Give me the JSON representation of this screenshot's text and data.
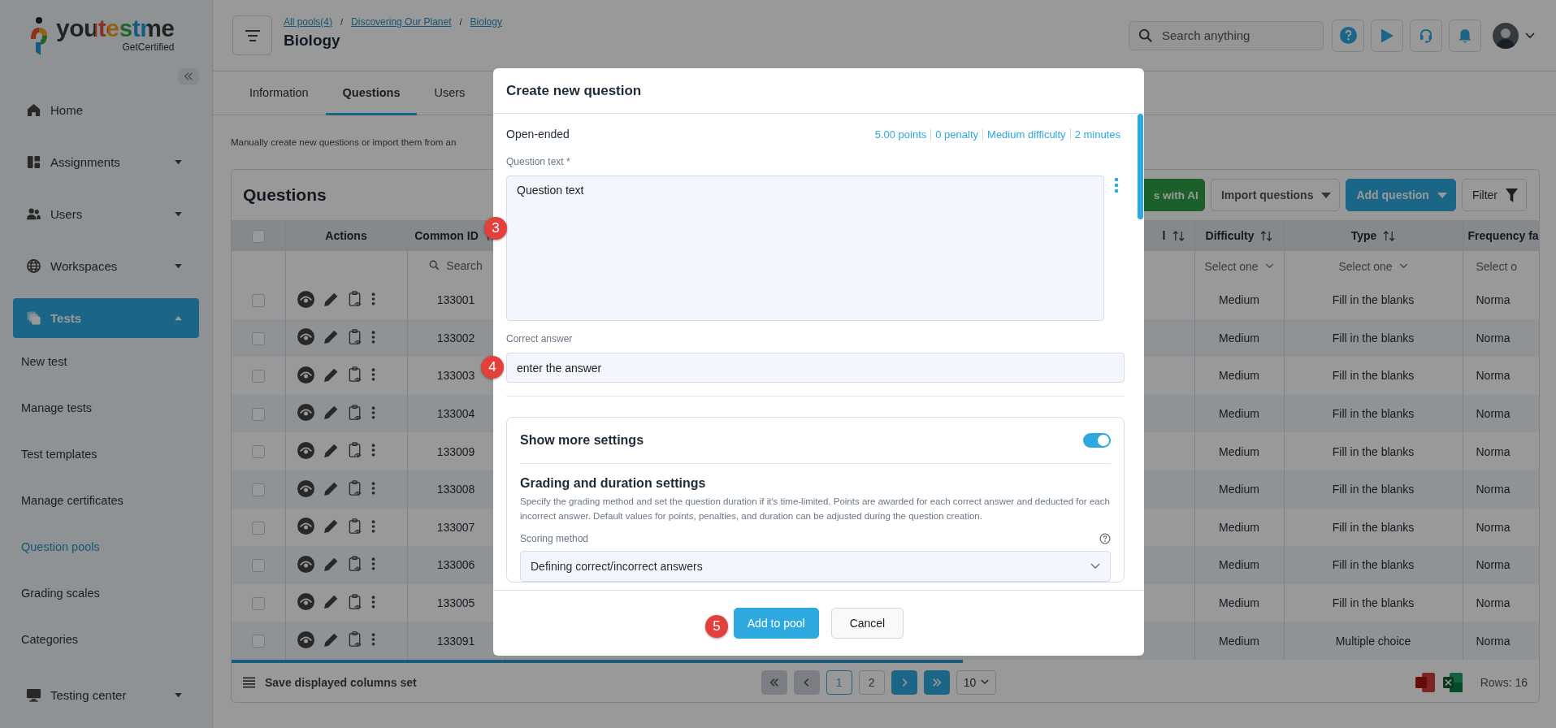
{
  "logo": {
    "name": "youtestme",
    "tagline": "GetCertified"
  },
  "sidebar": {
    "items": [
      {
        "label": "Home",
        "selected": false
      },
      {
        "label": "Assignments",
        "selected": false,
        "expanded": false
      },
      {
        "label": "Users",
        "selected": false,
        "expanded": false
      },
      {
        "label": "Workspaces",
        "selected": false,
        "expanded": false
      },
      {
        "label": "Tests",
        "selected": true,
        "expanded": true,
        "children": [
          {
            "label": "New test",
            "selected": false
          },
          {
            "label": "Manage tests",
            "selected": false
          },
          {
            "label": "Test templates",
            "selected": false
          },
          {
            "label": "Manage certificates",
            "selected": false
          },
          {
            "label": "Question pools",
            "selected": true
          },
          {
            "label": "Grading scales",
            "selected": false
          },
          {
            "label": "Categories",
            "selected": false
          }
        ]
      },
      {
        "label": "Testing center",
        "selected": false,
        "expanded": false
      }
    ]
  },
  "header": {
    "breadcrumbs": [
      {
        "label": "All pools(4)"
      },
      {
        "separator": "/",
        "label": "Discovering Our Planet"
      },
      {
        "separator": "/",
        "label": "Biology"
      }
    ],
    "title": "Biology",
    "search": {
      "placeholder": "Search anything"
    }
  },
  "tabs": [
    {
      "label": "Information",
      "selected": false
    },
    {
      "label": "Questions",
      "selected": true
    },
    {
      "label": "Users",
      "selected": false
    }
  ],
  "description": "Manually create new questions or import them from an",
  "card": {
    "title": "Questions",
    "toolbar": [
      {
        "label": "s with AI",
        "kind": "ai",
        "dropdown": false
      },
      {
        "label": "Import questions",
        "kind": "outline",
        "dropdown": true
      },
      {
        "label": "Add question",
        "kind": "primary",
        "dropdown": true
      },
      {
        "label": "Filter",
        "kind": "filter",
        "dropdown": false
      }
    ],
    "table": {
      "columns": [
        {
          "checked": false
        },
        {
          "label": "Actions",
          "sortable": false
        },
        {
          "label": "Common ID",
          "sortable": true,
          "filter": {
            "kind": "search",
            "placeholder": "Search"
          }
        },
        {
          "label": "l",
          "sortable": true
        },
        {
          "label": "Difficulty",
          "sortable": true,
          "filter": {
            "kind": "select",
            "placeholder": "Select one"
          }
        },
        {
          "label": "Type",
          "sortable": true,
          "filter": {
            "kind": "select",
            "placeholder": "Select one"
          }
        },
        {
          "label": "Frequency fa",
          "sortable": false,
          "filter": {
            "kind": "select",
            "placeholder": "Select o"
          }
        }
      ],
      "rows": [
        {
          "checked": false,
          "common_id": "133001",
          "difficulty": "Medium",
          "type": "Fill in the blanks",
          "column_7": "Norma"
        },
        {
          "checked": false,
          "common_id": "133002",
          "difficulty": "Medium",
          "type": "Fill in the blanks",
          "column_7": "Norma"
        },
        {
          "checked": false,
          "common_id": "133003",
          "difficulty": "Medium",
          "type": "Fill in the blanks",
          "column_7": "Norma"
        },
        {
          "checked": false,
          "common_id": "133004",
          "difficulty": "Medium",
          "type": "Fill in the blanks",
          "column_7": "Norma"
        },
        {
          "checked": false,
          "common_id": "133009",
          "difficulty": "Medium",
          "type": "Fill in the blanks",
          "column_7": "Norma"
        },
        {
          "checked": false,
          "common_id": "133008",
          "difficulty": "Medium",
          "type": "Fill in the blanks",
          "column_7": "Norma"
        },
        {
          "checked": false,
          "common_id": "133007",
          "difficulty": "Medium",
          "type": "Fill in the blanks",
          "column_7": "Norma"
        },
        {
          "checked": false,
          "common_id": "133006",
          "difficulty": "Medium",
          "type": "Fill in the blanks",
          "column_7": "Norma"
        },
        {
          "checked": false,
          "common_id": "133005",
          "difficulty": "Medium",
          "type": "Fill in the blanks",
          "column_7": "Norma"
        },
        {
          "checked": false,
          "common_id": "133091",
          "difficulty": "Medium",
          "type": "Multiple choice",
          "column_7": "Norma"
        }
      ]
    },
    "footer": {
      "save_columns": "Save displayed columns set",
      "pagination": {
        "first_disabled": true,
        "prev_disabled": true,
        "next_disabled": false,
        "last_disabled": false,
        "pages": [
          {
            "label": "1",
            "selected": true
          },
          {
            "label": "2",
            "selected": false
          }
        ],
        "page_size": "10"
      },
      "rows_count": "Rows: 16"
    }
  },
  "modal": {
    "title": "Create new question",
    "question_type": "Open-ended",
    "meta": [
      "5.00 points",
      "0 penalty",
      "Medium difficulty",
      "2 minutes"
    ],
    "question_label": "Question text *",
    "question_value": "Question text",
    "answer_label": "Correct answer",
    "answer_value": "enter the answer",
    "settings": {
      "title": "Show more settings",
      "on": true
    },
    "grading": {
      "title": "Grading and duration settings",
      "description": "Specify the grading method and set the question duration if it's time-limited. Points are awarded for each correct answer and deducted for each incorrect answer. Default values for points, penalties, and duration can be adjusted during the question creation.",
      "scoring_label": "Scoring method",
      "scoring_value": "Defining correct/incorrect answers"
    },
    "buttons": [
      {
        "label": "Add to pool",
        "kind": "primary"
      },
      {
        "label": "Cancel",
        "kind": "secondary"
      }
    ]
  },
  "markers": [
    {
      "label": "3"
    },
    {
      "label": "4"
    },
    {
      "label": "5"
    }
  ]
}
